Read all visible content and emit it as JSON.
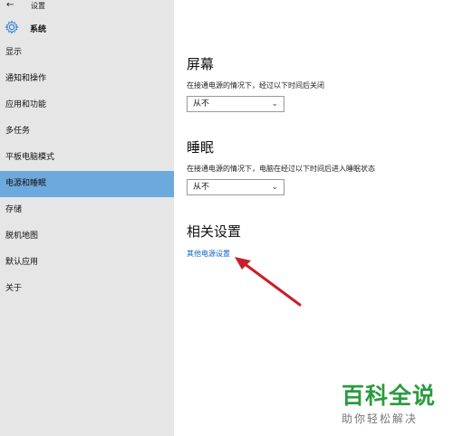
{
  "window": {
    "title": "设置"
  },
  "sidebar": {
    "section_title": "系统",
    "items": [
      {
        "label": "显示"
      },
      {
        "label": "通知和操作"
      },
      {
        "label": "应用和功能"
      },
      {
        "label": "多任务"
      },
      {
        "label": "平板电脑模式"
      },
      {
        "label": "电源和睡眠",
        "active": true
      },
      {
        "label": "存储"
      },
      {
        "label": "脱机地图"
      },
      {
        "label": "默认应用"
      },
      {
        "label": "关于"
      }
    ]
  },
  "screen": {
    "heading": "屏幕",
    "description": "在接通电源的情况下，经过以下时间后关闭",
    "dropdown_value": "从不"
  },
  "sleep": {
    "heading": "睡眠",
    "description": "在接通电源的情况下，电脑在经过以下时间后进入睡眠状态",
    "dropdown_value": "从不"
  },
  "related": {
    "heading": "相关设置",
    "link": "其他电源设置"
  },
  "watermark": {
    "title": "百科全说",
    "subtitle": "助你轻松解决"
  },
  "colors": {
    "accent": "#6ea9dd",
    "link": "#0a64c8",
    "arrow": "#c8202a",
    "watermark": "#2a9b3e"
  }
}
